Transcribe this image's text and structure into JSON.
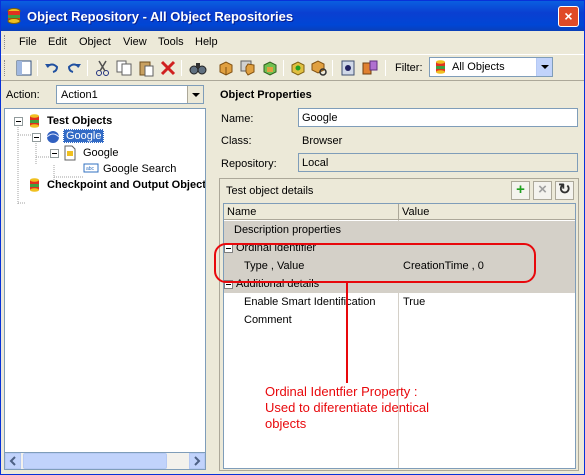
{
  "window": {
    "title": "Object Repository - All Object Repositories",
    "close_glyph": "×"
  },
  "menu": {
    "items": [
      "File",
      "Edit",
      "Object",
      "View",
      "Tools",
      "Help"
    ]
  },
  "toolbar": {
    "filter_label": "Filter:",
    "filter_value": "All Objects"
  },
  "left": {
    "action_label": "Action:",
    "action_value": "Action1",
    "tree": {
      "test_objects": "Test Objects",
      "browser": "Google",
      "page": "Google",
      "edit_field": "Google Search",
      "checkpoints": "Checkpoint and Output Object"
    }
  },
  "properties": {
    "header": "Object Properties",
    "name_label": "Name:",
    "name_value": "Google",
    "class_label": "Class:",
    "class_value": "Browser",
    "repository_label": "Repository:",
    "repository_value": "Local",
    "details_title": "Test object details",
    "add_glyph": "+",
    "remove_glyph": "×",
    "refresh_glyph": "↻"
  },
  "grid": {
    "columns": [
      "Name",
      "Value"
    ],
    "rows": [
      {
        "name": "Description properties",
        "value": ""
      },
      {
        "name": "Ordinal identifier",
        "value": ""
      },
      {
        "name": "Type , Value",
        "value": "CreationTime , 0"
      },
      {
        "name": "Additional details",
        "value": ""
      },
      {
        "name": "Enable Smart Identification",
        "value": "True"
      },
      {
        "name": "Comment",
        "value": ""
      }
    ]
  },
  "annotation": {
    "line1": "Ordinal Identfier Property :",
    "line2": "Used to diferentiate identical",
    "line3": "objects"
  },
  "colors": {
    "title_bar": "#0a3fd1",
    "annotation": "#e8080c",
    "selection": "#316ac5"
  }
}
